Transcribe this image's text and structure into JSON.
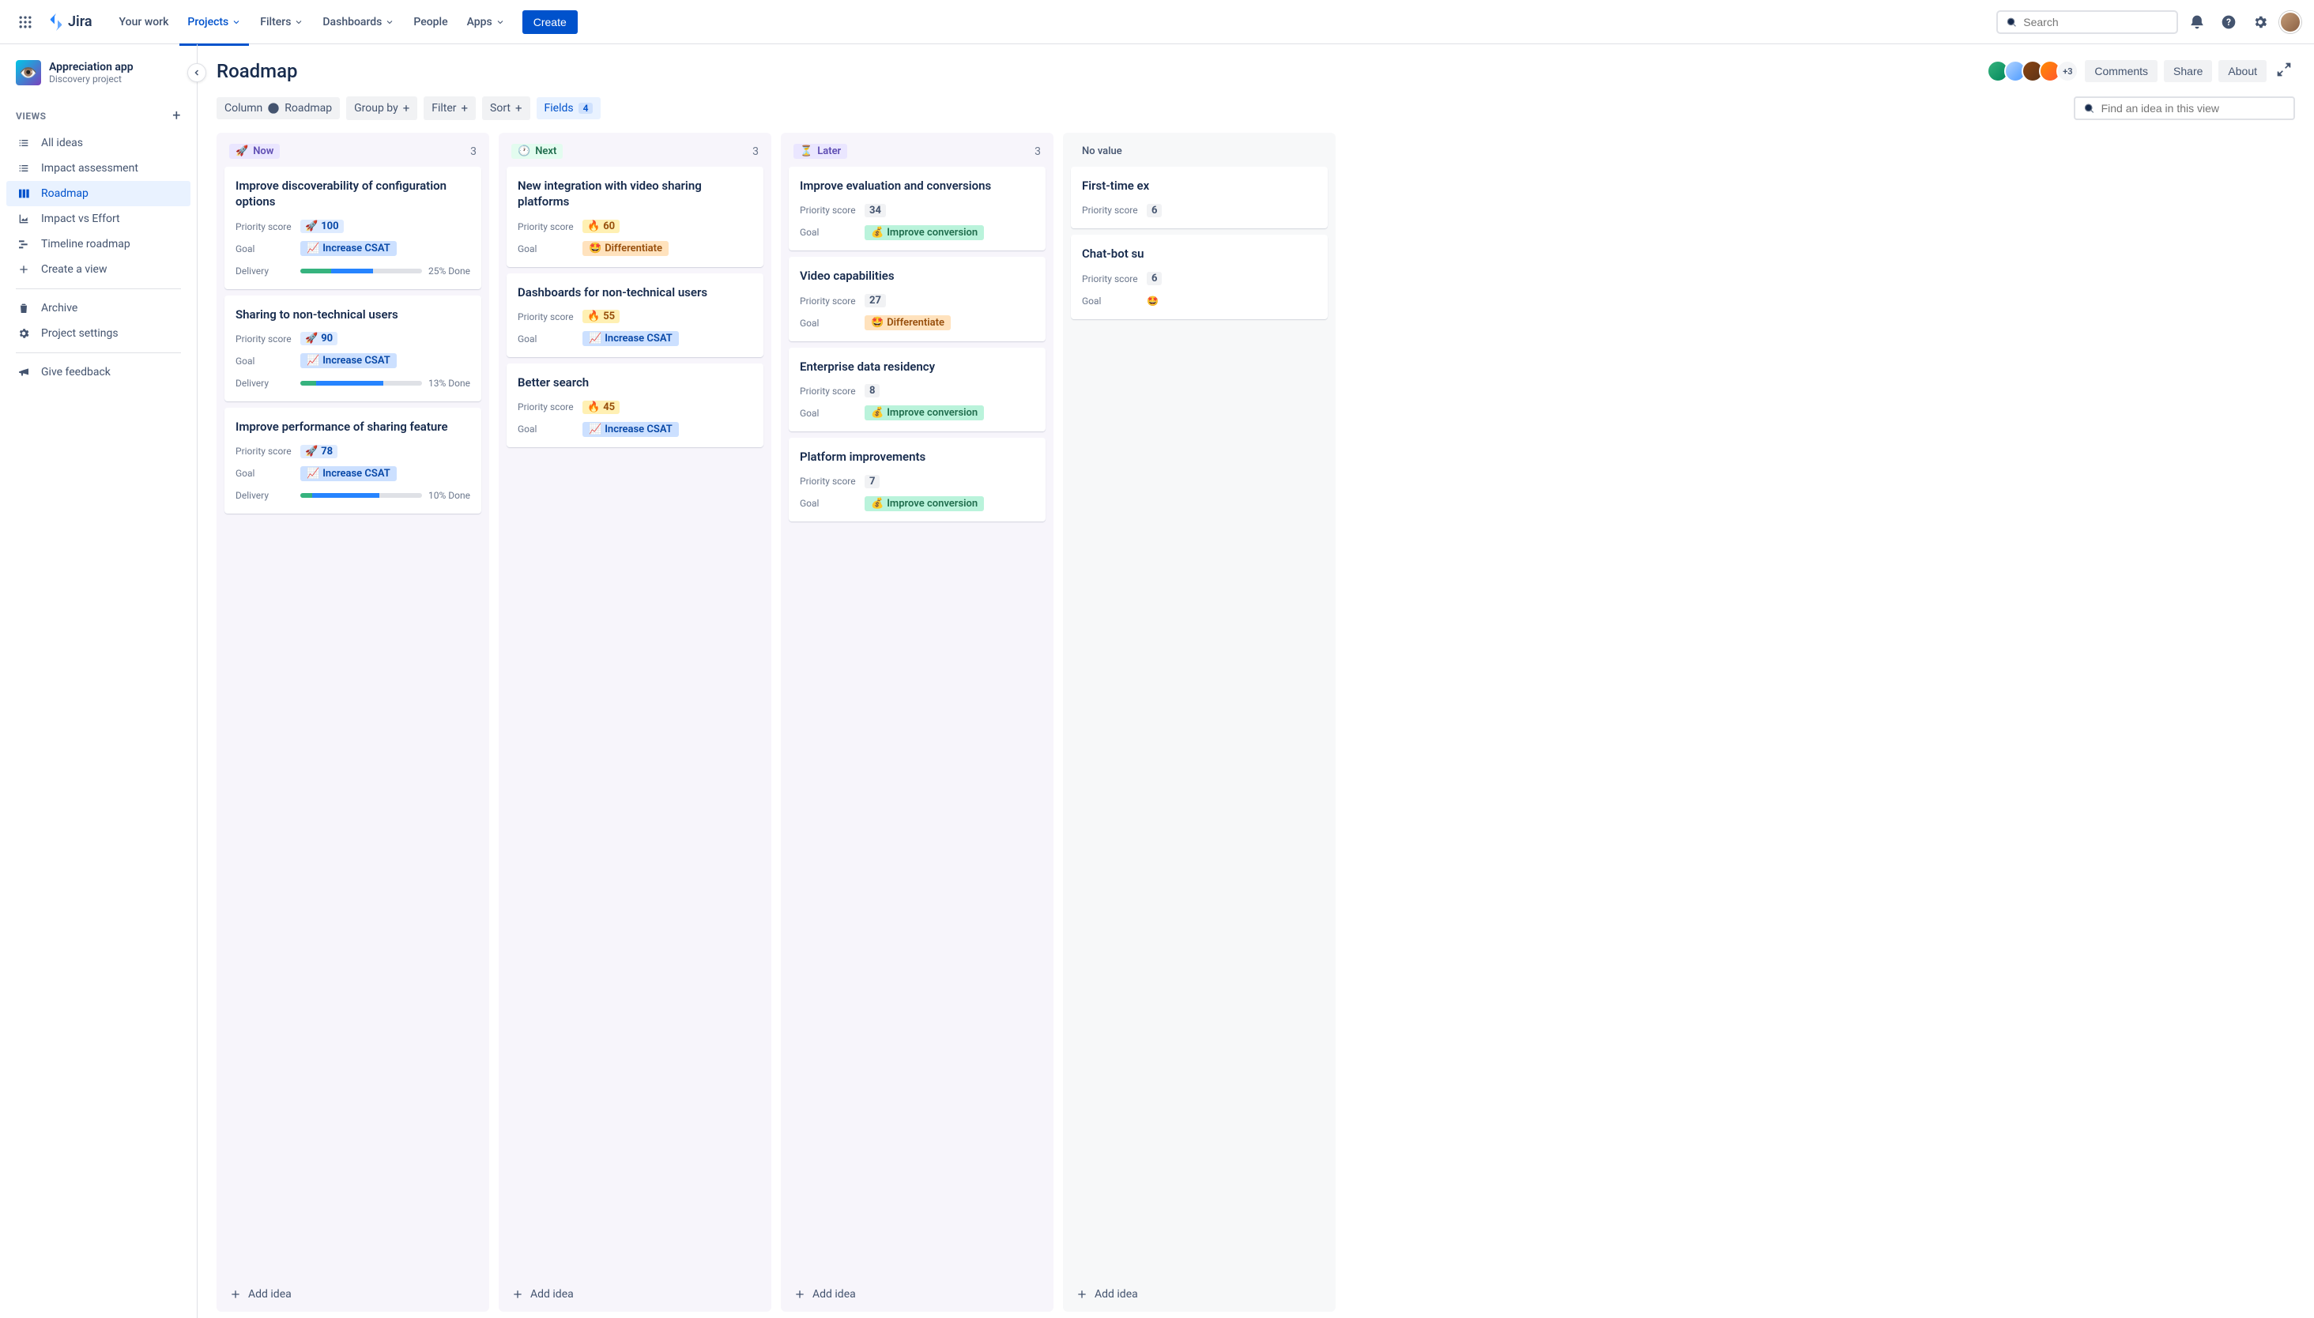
{
  "nav": {
    "logo_text": "Jira",
    "items": [
      {
        "label": "Your work",
        "dropdown": false
      },
      {
        "label": "Projects",
        "dropdown": true,
        "active": true
      },
      {
        "label": "Filters",
        "dropdown": true
      },
      {
        "label": "Dashboards",
        "dropdown": true
      },
      {
        "label": "People",
        "dropdown": false
      },
      {
        "label": "Apps",
        "dropdown": true
      }
    ],
    "create_label": "Create",
    "search_placeholder": "Search"
  },
  "sidebar": {
    "project_name": "Appreciation app",
    "project_type": "Discovery project",
    "views_label": "VIEWS",
    "items": [
      {
        "icon": "list",
        "label": "All ideas"
      },
      {
        "icon": "list",
        "label": "Impact assessment"
      },
      {
        "icon": "board",
        "label": "Roadmap",
        "active": true
      },
      {
        "icon": "chart",
        "label": "Impact vs Effort"
      },
      {
        "icon": "timeline",
        "label": "Timeline roadmap"
      },
      {
        "icon": "plus",
        "label": "Create a view"
      }
    ],
    "archive_label": "Archive",
    "settings_label": "Project settings",
    "feedback_label": "Give feedback"
  },
  "page": {
    "title": "Roadmap",
    "avatars_more": "+3",
    "comments_label": "Comments",
    "share_label": "Share",
    "about_label": "About"
  },
  "toolbar": {
    "column_label": "Column",
    "column_value": "Roadmap",
    "groupby_label": "Group by",
    "filter_label": "Filter",
    "sort_label": "Sort",
    "fields_label": "Fields",
    "fields_count": "4",
    "find_placeholder": "Find an idea in this view"
  },
  "labels": {
    "priority": "Priority score",
    "goal": "Goal",
    "delivery": "Delivery",
    "add_idea": "Add idea"
  },
  "columns": [
    {
      "key": "now",
      "emoji": "🚀",
      "label": "Now",
      "count": "3",
      "cards": [
        {
          "title": "Improve discoverability of configuration options",
          "score_emoji": "🚀",
          "score": "100",
          "score_style": "rocket",
          "goal_emoji": "📈",
          "goal": "Increase CSAT",
          "goal_style": "csat",
          "delivery_done": 25,
          "delivery_progress": 35,
          "delivery_label": "25% Done"
        },
        {
          "title": "Sharing to non-technical users",
          "score_emoji": "🚀",
          "score": "90",
          "score_style": "rocket",
          "goal_emoji": "📈",
          "goal": "Increase CSAT",
          "goal_style": "csat",
          "delivery_done": 13,
          "delivery_progress": 55,
          "delivery_label": "13% Done"
        },
        {
          "title": "Improve performance of sharing feature",
          "score_emoji": "🚀",
          "score": "78",
          "score_style": "rocket",
          "goal_emoji": "📈",
          "goal": "Increase CSAT",
          "goal_style": "csat",
          "delivery_done": 10,
          "delivery_progress": 55,
          "delivery_label": "10% Done"
        }
      ]
    },
    {
      "key": "next",
      "emoji": "🕐",
      "label": "Next",
      "count": "3",
      "cards": [
        {
          "title": "New integration with video sharing platforms",
          "score_emoji": "🔥",
          "score": "60",
          "score_style": "fire",
          "goal_emoji": "🤩",
          "goal": "Differentiate",
          "goal_style": "diff"
        },
        {
          "title": "Dashboards for non-technical users",
          "score_emoji": "🔥",
          "score": "55",
          "score_style": "fire",
          "goal_emoji": "📈",
          "goal": "Increase CSAT",
          "goal_style": "csat"
        },
        {
          "title": "Better search",
          "score_emoji": "🔥",
          "score": "45",
          "score_style": "fire",
          "goal_emoji": "📈",
          "goal": "Increase CSAT",
          "goal_style": "csat"
        }
      ]
    },
    {
      "key": "later",
      "emoji": "⏳",
      "label": "Later",
      "count": "3",
      "cards": [
        {
          "title": "Improve evaluation and conversions",
          "score": "34",
          "score_style": "gray",
          "goal_emoji": "💰",
          "goal": "Improve conversion",
          "goal_style": "conv"
        },
        {
          "title": "Video capabilities",
          "score": "27",
          "score_style": "gray",
          "goal_emoji": "🤩",
          "goal": "Differentiate",
          "goal_style": "diff"
        },
        {
          "title": "Enterprise data residency",
          "score": "8",
          "score_style": "gray",
          "goal_emoji": "💰",
          "goal": "Improve conversion",
          "goal_style": "conv"
        },
        {
          "title": "Platform improvements",
          "score": "7",
          "score_style": "gray",
          "goal_emoji": "💰",
          "goal": "Improve conversion",
          "goal_style": "conv"
        }
      ]
    },
    {
      "key": "novalue",
      "label": "No value",
      "count": "",
      "cards": [
        {
          "title": "First-time ex",
          "score": "6",
          "score_style": "gray"
        },
        {
          "title": "Chat-bot su",
          "score": "6",
          "score_style": "gray",
          "goal_emoji": "🤩"
        }
      ]
    }
  ]
}
